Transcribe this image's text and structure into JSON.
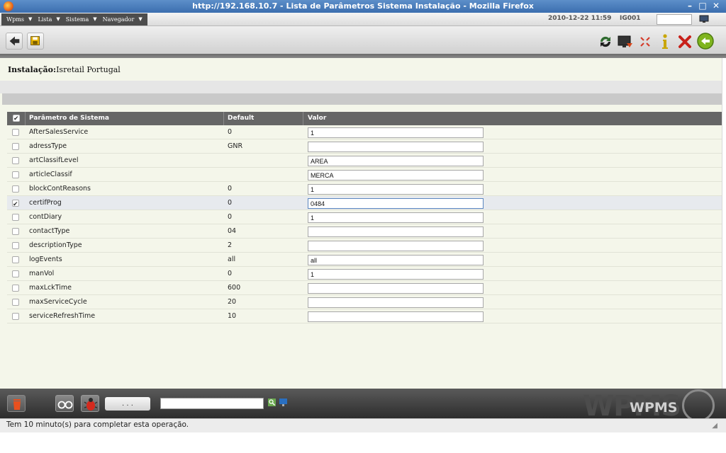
{
  "window": {
    "title": "http://192.168.10.7 - Lista de Parâmetros Sistema Instalação - Mozilla Firefox",
    "controls": [
      "–",
      "□",
      "✕"
    ]
  },
  "menubar": {
    "menus": [
      {
        "label": "Wpms"
      },
      {
        "label": "Lista"
      },
      {
        "label": "Sistema"
      },
      {
        "label": "Navegador"
      }
    ],
    "datetime": "2010-12-22 11:59",
    "user_code": "IG001",
    "input_value": ""
  },
  "toolbar": {
    "left_icons": [
      "back-arrow-icon",
      "save-icon"
    ],
    "right_icons": [
      "refresh-icon",
      "export-icon",
      "fullscreen-icon",
      "info-icon",
      "close-icon",
      "exit-icon"
    ]
  },
  "installation": {
    "label": "Instalação:",
    "value": "Isretail Portugal"
  },
  "grid": {
    "headers": {
      "param": "Parâmetro de Sistema",
      "default": "Default",
      "value": "Valor"
    },
    "rows": [
      {
        "name": "AfterSalesService",
        "default": "0",
        "value": "1",
        "checked": false
      },
      {
        "name": "adressType",
        "default": "GNR",
        "value": "",
        "checked": false
      },
      {
        "name": "artClassifLevel",
        "default": "",
        "value": "AREA",
        "checked": false
      },
      {
        "name": "articleClassif",
        "default": "",
        "value": "MERCA",
        "checked": false
      },
      {
        "name": "blockContReasons",
        "default": "0",
        "value": "1",
        "checked": false
      },
      {
        "name": "certifProg",
        "default": "0",
        "value": "0484",
        "checked": true
      },
      {
        "name": "contDiary",
        "default": "0",
        "value": "1",
        "checked": false
      },
      {
        "name": "contactType",
        "default": "04",
        "value": "",
        "checked": false
      },
      {
        "name": "descriptionType",
        "default": "2",
        "value": "",
        "checked": false
      },
      {
        "name": "logEvents",
        "default": "all",
        "value": "all",
        "checked": false
      },
      {
        "name": "manVol",
        "default": "0",
        "value": "1",
        "checked": false
      },
      {
        "name": "maxLckTime",
        "default": "600",
        "value": "",
        "checked": false
      },
      {
        "name": "maxServiceCycle",
        "default": "20",
        "value": "",
        "checked": false
      },
      {
        "name": "serviceRefreshTime",
        "default": "10",
        "value": "",
        "checked": false
      }
    ]
  },
  "footer": {
    "dots_label": ". . .",
    "search_value": "",
    "logo_big": "WPMS",
    "logo_small": "WPMS"
  },
  "status": {
    "text": "Tem 10 minuto(s) para completar esta operação."
  }
}
